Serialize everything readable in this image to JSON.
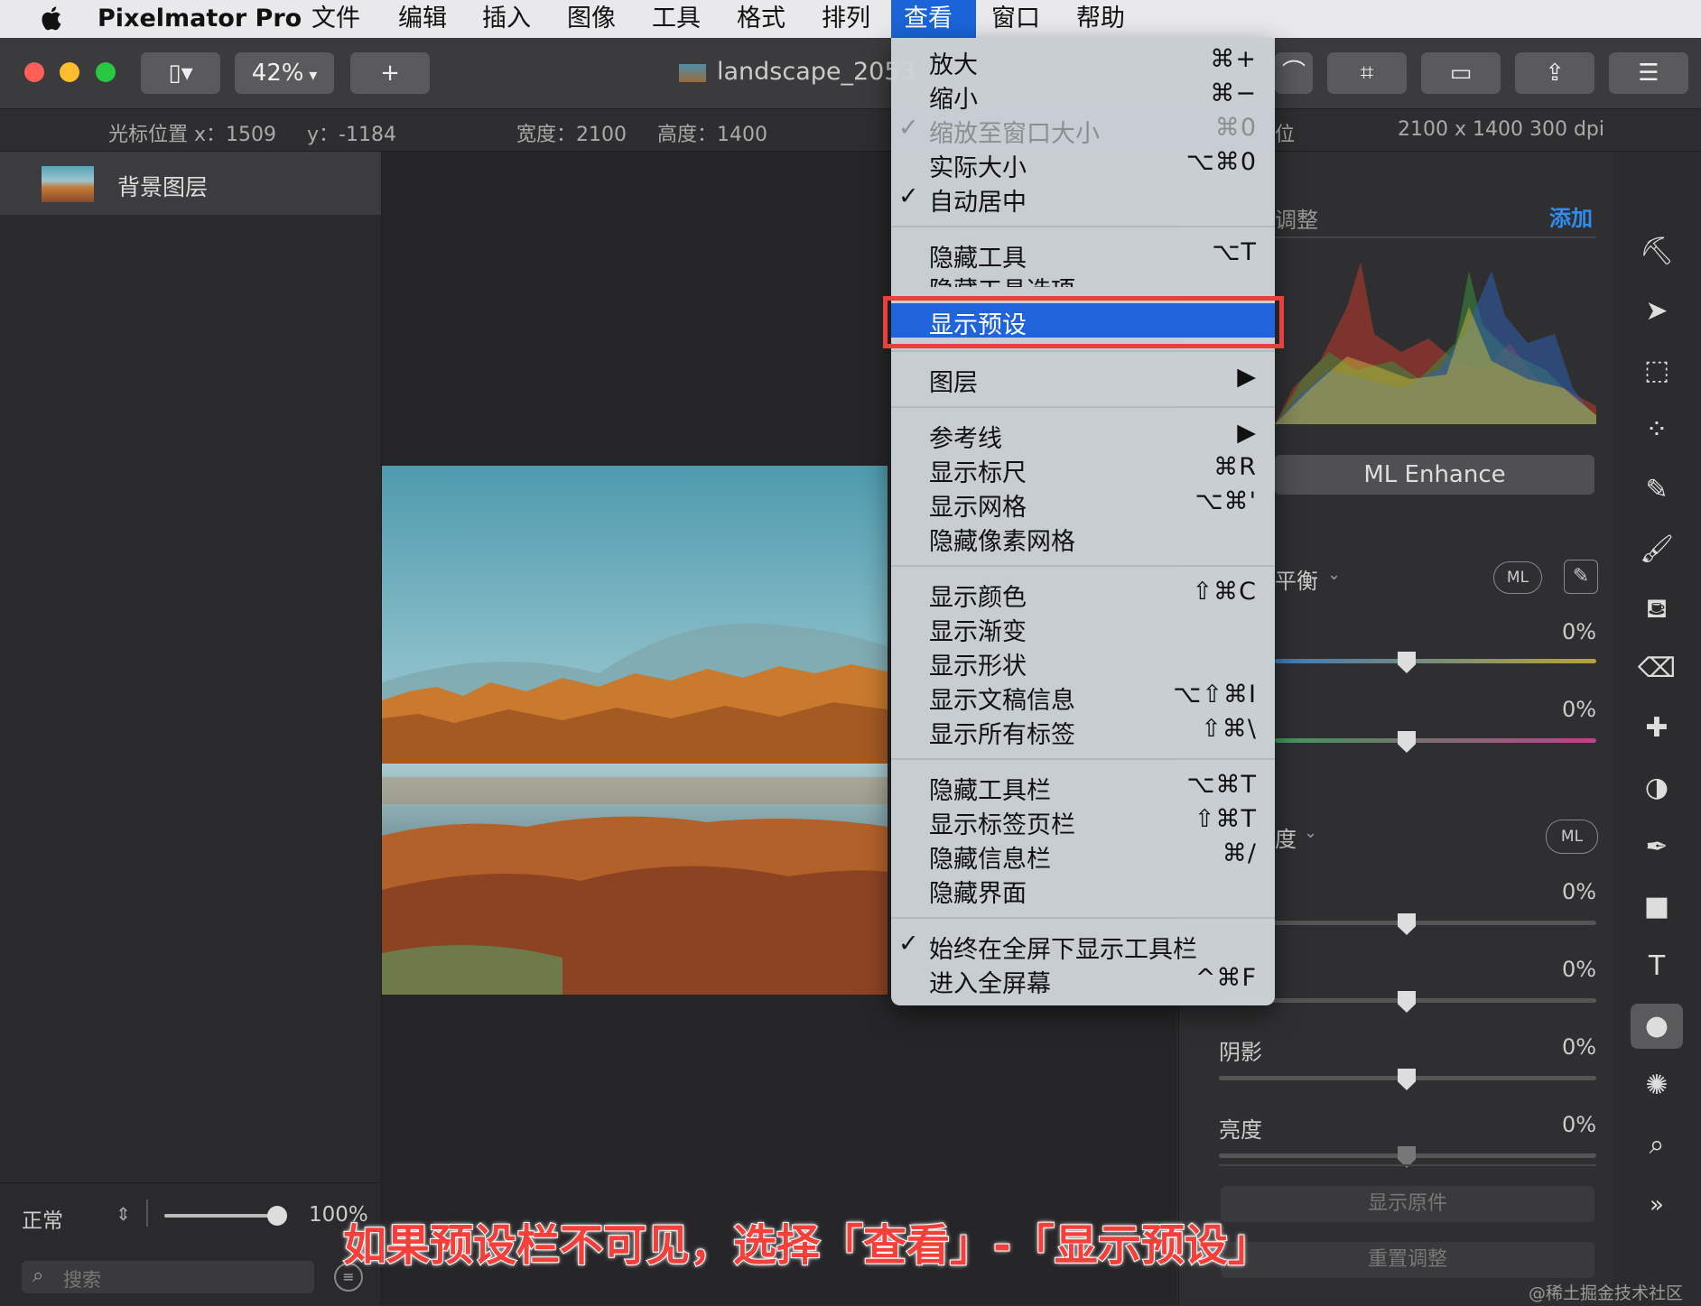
{
  "menubar": {
    "app": "Pixelmator Pro",
    "items": [
      "文件",
      "编辑",
      "插入",
      "图像",
      "工具",
      "格式",
      "排列",
      "查看",
      "窗口",
      "帮助"
    ]
  },
  "toolbar": {
    "zoom": "42%",
    "add": "+",
    "doc_title": "landscape_2053"
  },
  "infobar": {
    "cursor_x": "光标位置 x：1509",
    "cursor_y": "y：-1184",
    "width": "宽度：2100",
    "height": "高度：1400",
    "pos_tail": "位",
    "dims": "2100 x 1400 300 dpi"
  },
  "layers": {
    "name": "背景图层",
    "blend": "正常",
    "opacity": "100%",
    "search_placeholder": "搜索"
  },
  "adjust": {
    "header_partial": "调整",
    "add": "添加",
    "ml_enhance": "ML Enhance",
    "wb_partial": "平衡",
    "ml": "ML",
    "pct1": "0%",
    "pct2": "0%",
    "sat_partial": "度",
    "pct3": "0%",
    "pct4": "0%",
    "shadow": "阴影",
    "pct5": "0%",
    "brightness": "亮度",
    "pct6": "0%",
    "show_original": "显示原件",
    "reset": "重置调整"
  },
  "view_menu": [
    {
      "label": "放大",
      "shortcut": "⌘+",
      "check": ""
    },
    {
      "label": "缩小",
      "shortcut": "⌘−",
      "check": ""
    },
    {
      "label": "缩放至窗口大小",
      "shortcut": "⌘0",
      "check": "✓",
      "disabled": true
    },
    {
      "label": "实际大小",
      "shortcut": "⌥⌘0",
      "check": ""
    },
    {
      "label": "自动居中",
      "shortcut": "",
      "check": "✓"
    },
    {
      "label": "隐藏工具",
      "shortcut": "⌥T",
      "check": ""
    },
    {
      "label": "隐藏工具选项",
      "shortcut": "",
      "check": ""
    },
    {
      "label": "显示预设",
      "shortcut": "",
      "check": "",
      "highlight": true
    },
    {
      "label": "图层",
      "shortcut": "▶",
      "check": ""
    },
    {
      "label": "参考线",
      "shortcut": "▶",
      "check": ""
    },
    {
      "label": "显示标尺",
      "shortcut": "⌘R",
      "check": ""
    },
    {
      "label": "显示网格",
      "shortcut": "⌥⌘'",
      "check": ""
    },
    {
      "label": "隐藏像素网格",
      "shortcut": "",
      "check": ""
    },
    {
      "label": "显示颜色",
      "shortcut": "⇧⌘C",
      "check": ""
    },
    {
      "label": "显示渐变",
      "shortcut": "",
      "check": ""
    },
    {
      "label": "显示形状",
      "shortcut": "",
      "check": ""
    },
    {
      "label": "显示文稿信息",
      "shortcut": "⌥⇧⌘I",
      "check": ""
    },
    {
      "label": "显示所有标签",
      "shortcut": "⇧⌘\\",
      "check": ""
    },
    {
      "label": "隐藏工具栏",
      "shortcut": "⌥⌘T",
      "check": ""
    },
    {
      "label": "显示标签页栏",
      "shortcut": "⇧⌘T",
      "check": ""
    },
    {
      "label": "隐藏信息栏",
      "shortcut": "⌘/",
      "check": ""
    },
    {
      "label": "隐藏界面",
      "shortcut": "",
      "check": ""
    },
    {
      "label": "始终在全屏下显示工具栏",
      "shortcut": "",
      "check": "✓"
    },
    {
      "label": "进入全屏幕",
      "shortcut": "^⌘F",
      "check": ""
    }
  ],
  "caption": "如果预设栏不可见，选择「查看」-「显示预设」",
  "watermark": "@稀土掘金技术社区",
  "colors": {
    "accent": "#1f64d9",
    "highlight_box": "#e8403c",
    "caption": "#f43f3a"
  }
}
